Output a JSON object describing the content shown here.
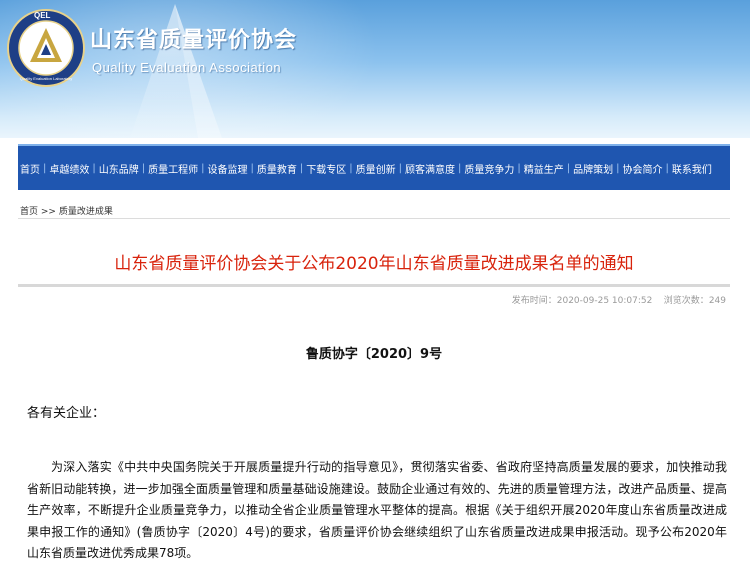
{
  "header": {
    "logo_text": "QEL",
    "logo_ring_text": "Quality Evaluation Laboratory",
    "site_name": "山东省质量评价协会",
    "site_name_en": "Quality Evaluation Association"
  },
  "nav": {
    "items": [
      "首页",
      "卓越绩效",
      "山东品牌",
      "质量工程师",
      "设备监理",
      "质量教育",
      "下载专区",
      "质量创新",
      "顾客满意度",
      "质量竞争力",
      "精益生产",
      "品牌策划",
      "协会简介",
      "联系我们"
    ],
    "separator": "|"
  },
  "breadcrumb": {
    "home": "首页",
    "sep": ">>",
    "current": "质量改进成果"
  },
  "article": {
    "title": "山东省质量评价协会关于公布2020年山东省质量改进成果名单的通知",
    "publish_label": "发布时间：",
    "publish_time": "2020-09-25 10:07:52",
    "views_label": "浏览次数：",
    "views": "249",
    "doc_number": "鲁质协字〔2020〕9号",
    "greeting": "各有关企业：",
    "paragraph": "为深入落实《中共中央国务院关于开展质量提升行动的指导意见》，贯彻落实省委、省政府坚持高质量发展的要求，加快推动我省新旧动能转换，进一步加强全面质量管理和质量基础设施建设。鼓励企业通过有效的、先进的质量管理方法，改进产品质量、提高生产效率，不断提升企业质量竞争力，以推动全省企业质量管理水平整体的提高。根据《关于组织开展2020年度山东省质量改进成果申报工作的通知》(鲁质协字〔2020〕4号)的要求，省质量评价协会继续组织了山东省质量改进成果申报活动。现予公布2020年山东省质量改进优秀成果78项。"
  },
  "colors": {
    "nav_bg": "#1f56b0",
    "title_red": "#d8230c",
    "banner_blue": "#5aa0dc"
  }
}
